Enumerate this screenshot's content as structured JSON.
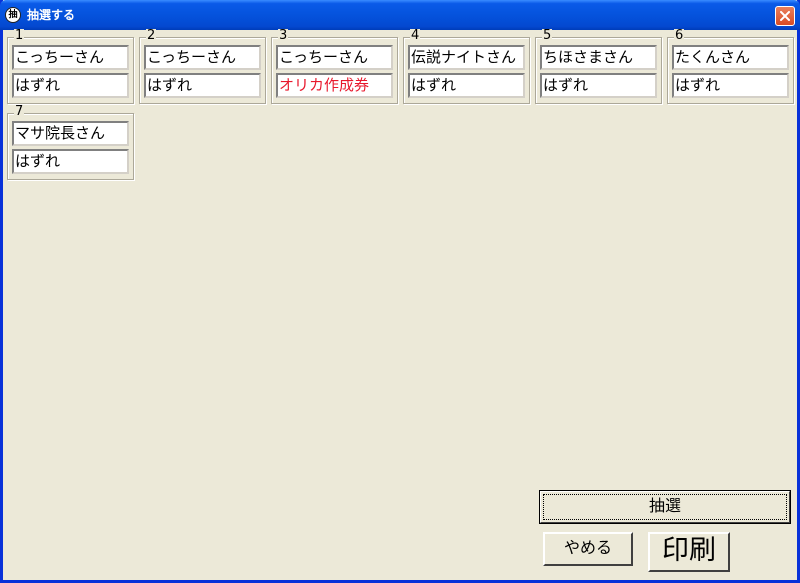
{
  "window": {
    "title": "抽選する",
    "app_icon_text": "抽"
  },
  "entries": [
    {
      "number": "1",
      "name": "こっちーさん",
      "result": "はずれ"
    },
    {
      "number": "2",
      "name": "こっちーさん",
      "result": "はずれ"
    },
    {
      "number": "3",
      "name": "こっちーさん",
      "result": "オリカ作成券"
    },
    {
      "number": "4",
      "name": "伝説ナイトさん",
      "result": "はずれ"
    },
    {
      "number": "5",
      "name": "ちほさまさん",
      "result": "はずれ"
    },
    {
      "number": "6",
      "name": "たくんさん",
      "result": "はずれ"
    },
    {
      "number": "7",
      "name": "マサ院長さん",
      "result": "はずれ"
    }
  ],
  "buttons": {
    "draw": "抽選",
    "cancel": "やめる",
    "print": "印刷"
  },
  "colors": {
    "title_bar": "#0553dd",
    "win_text": "#e8182c",
    "face": "#ece9d8"
  }
}
